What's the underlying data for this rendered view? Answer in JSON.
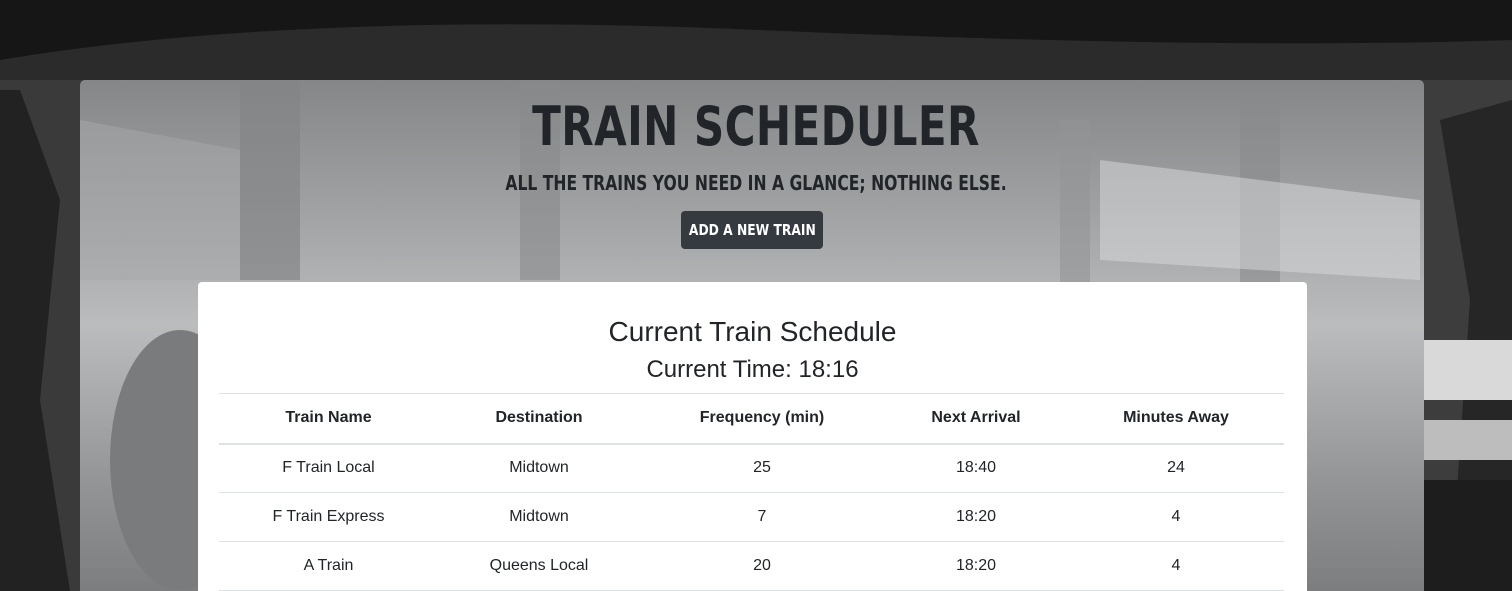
{
  "header": {
    "title": "TRAIN SCHEDULER",
    "subtitle": "ALL THE TRAINS YOU NEED IN A GLANCE; NOTHING ELSE.",
    "add_button_label": "ADD A NEW TRAIN"
  },
  "schedule": {
    "title": "Current Train Schedule",
    "current_time": "Current Time: 18:16",
    "columns": [
      "Train Name",
      "Destination",
      "Frequency (min)",
      "Next Arrival",
      "Minutes Away"
    ],
    "rows": [
      [
        "F Train Local",
        "Midtown",
        "25",
        "18:40",
        "24"
      ],
      [
        "F Train Express",
        "Midtown",
        "7",
        "18:20",
        "4"
      ],
      [
        "A Train",
        "Queens Local",
        "20",
        "18:20",
        "4"
      ]
    ]
  },
  "colors": {
    "button_bg": "#343a40",
    "text": "#212529"
  }
}
